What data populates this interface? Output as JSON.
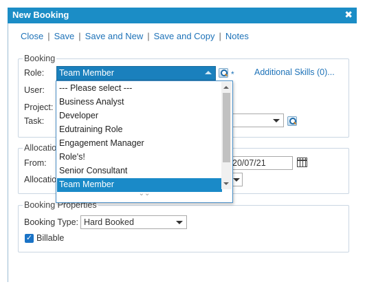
{
  "dialog": {
    "title": "New Booking",
    "close_glyph": "✖"
  },
  "toolbar": {
    "close": "Close",
    "save": "Save",
    "save_new": "Save and New",
    "save_copy": "Save and Copy",
    "notes": "Notes",
    "separator": "|"
  },
  "booking": {
    "legend": "Booking",
    "role_label": "Role:",
    "role_value": "Team Member",
    "user_label": "User:",
    "project_label": "Project:",
    "task_label": "Task:",
    "required_mark": "*",
    "additional_skills": "Additional Skills (0)..."
  },
  "allocation": {
    "legend": "Allocatio",
    "from_label": "From:",
    "from_value": "20/07/21",
    "allocation_label": "Allocatio"
  },
  "properties": {
    "legend": "Booking Properties",
    "type_label": "Booking Type:",
    "type_value": "Hard Booked",
    "billable_label": "Billable",
    "billable_checked": true
  },
  "role_dropdown": {
    "options": [
      "--- Please select ---",
      "Business Analyst",
      "Developer",
      "Edutraining Role",
      "Engagement Manager",
      "Role's!",
      "Senior Consultant",
      "Team Member"
    ],
    "selected": "Team Member",
    "more_glyph": "⌄⌄"
  },
  "colors": {
    "accent": "#1b8dc6",
    "selected": "#1a8ac8",
    "link": "#1d72b8"
  },
  "icons": [
    "close-icon",
    "search-icon",
    "calendar-icon",
    "chevron-down-icon",
    "check-icon"
  ]
}
